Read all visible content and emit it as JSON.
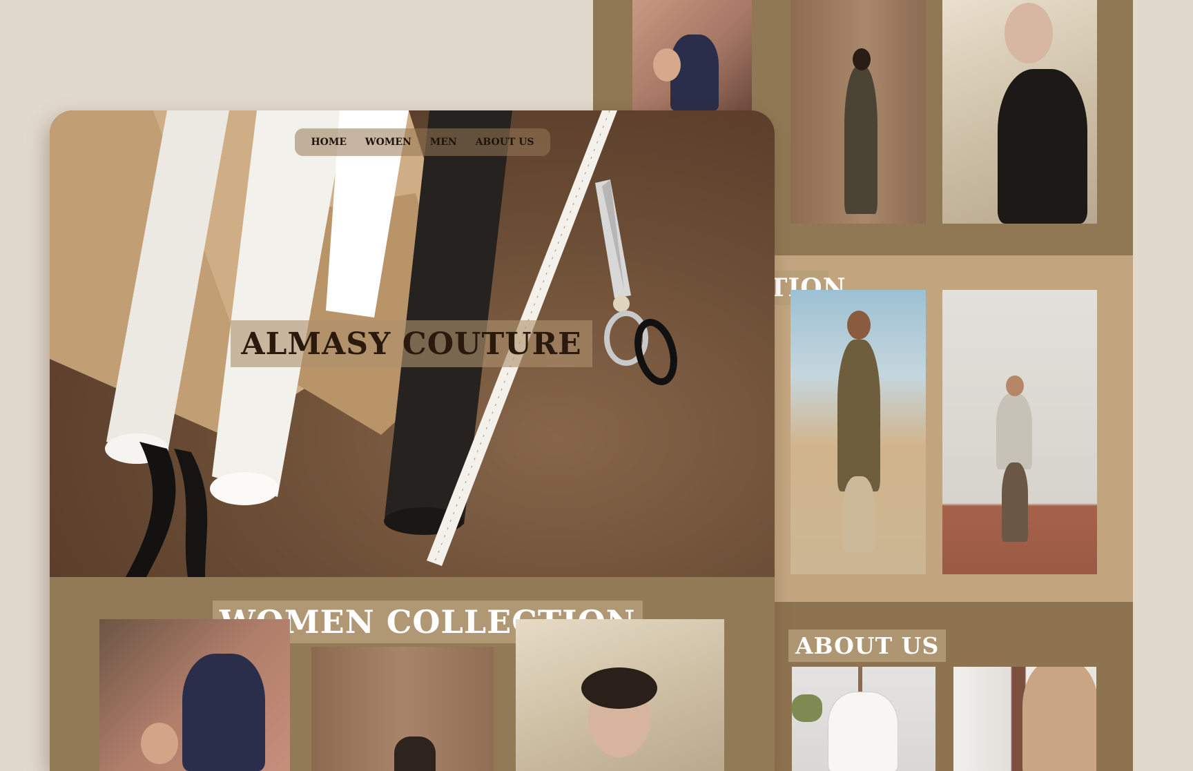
{
  "nav": {
    "items": [
      "HOME",
      "WOMEN",
      "MEN",
      "ABOUT US"
    ]
  },
  "hero": {
    "title": "ALMASY COUTURE"
  },
  "sections": {
    "women": {
      "title": "WOMEN COLLECTION"
    },
    "men": {
      "title": "EN COLLECTION"
    },
    "about": {
      "title": "ABOUT US"
    }
  },
  "colors": {
    "background": "#e2d9cd",
    "band_dark": "#917854",
    "band_light": "#c2a57f",
    "title_text": "#2a1a0e",
    "heading_white": "#ffffff"
  },
  "icons": [
    "fabric-roll-icon",
    "scissors-icon",
    "measuring-tape-icon"
  ]
}
